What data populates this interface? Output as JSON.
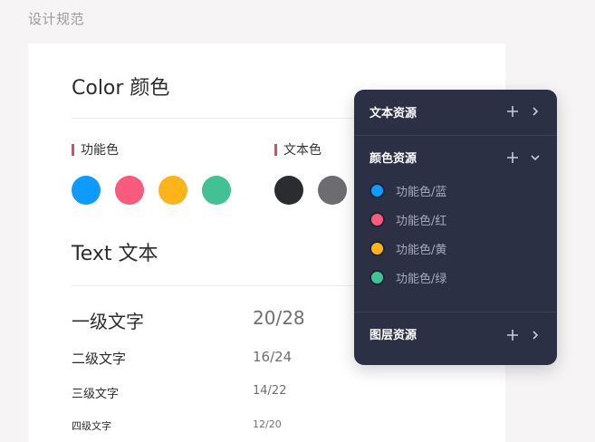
{
  "page": {
    "header": "设计规范"
  },
  "color_section": {
    "title": "Color 颜色",
    "functional": {
      "label": "功能色",
      "swatches": [
        "#0d9bff",
        "#fa5a7b",
        "#fdb31a",
        "#41c194"
      ]
    },
    "text": {
      "label": "文本色",
      "swatches": [
        "#2b2c30",
        "#6d6c70"
      ]
    },
    "marker_color": "#e0476c"
  },
  "text_section": {
    "title": "Text 文本",
    "levels": [
      {
        "name": "一级文字",
        "spec": "20/28"
      },
      {
        "name": "二级文字",
        "spec": "16/24"
      },
      {
        "name": "三级文字",
        "spec": "14/22"
      },
      {
        "name": "四级文字",
        "spec": "12/20"
      }
    ]
  },
  "panel": {
    "background": "#2b3044",
    "text_resources": {
      "title": "文本资源",
      "add_icon": "plus-icon",
      "toggle_icon": "chevron-right-icon"
    },
    "color_resources": {
      "title": "颜色资源",
      "add_icon": "plus-icon",
      "toggle_icon": "chevron-down-icon",
      "items": [
        {
          "label": "功能色/蓝",
          "color": "#0d9bff"
        },
        {
          "label": "功能色/红",
          "color": "#fa5a7b"
        },
        {
          "label": "功能色/黄",
          "color": "#fdb31a"
        },
        {
          "label": "功能色/绿",
          "color": "#41c194"
        }
      ]
    },
    "layer_resources": {
      "title": "图层资源",
      "add_icon": "plus-icon",
      "toggle_icon": "chevron-right-icon"
    }
  }
}
